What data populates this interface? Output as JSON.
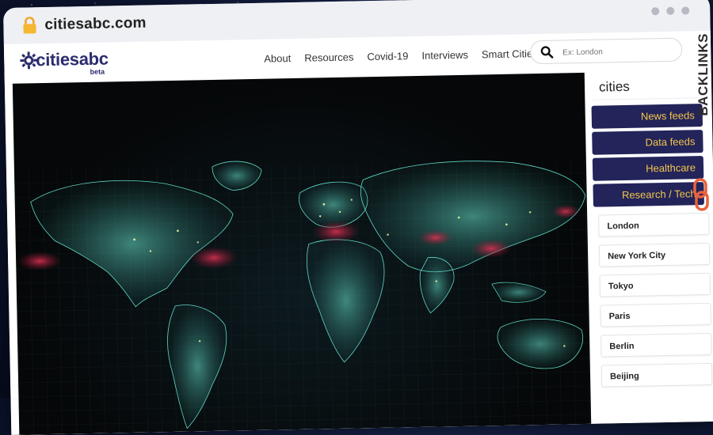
{
  "browser": {
    "url": "citiesabc.com"
  },
  "site": {
    "logo": {
      "name": "citiesabc",
      "badge": "beta"
    },
    "nav": [
      "About",
      "Resources",
      "Covid-19",
      "Interviews",
      "Smart Cities"
    ],
    "search": {
      "placeholder": "Ex: London",
      "value": ""
    }
  },
  "sidebar": {
    "title": "cities",
    "feeds": [
      "News feeds",
      "Data feeds",
      "Healthcare",
      "Research / Tech"
    ],
    "cities": [
      "London",
      "New York City",
      "Tokyo",
      "Paris",
      "Berlin",
      "Beijing"
    ]
  },
  "colors": {
    "nav_button_bg": "#23245a",
    "nav_button_text": "#f3c64a",
    "brand": "#2b2d6e",
    "hero_bg": "#050708",
    "map_glow": "#49d3c4",
    "hotspot": "#d2284b"
  },
  "watermark": {
    "text": "BACKLINKS"
  },
  "icons": {
    "lock": "lock-icon",
    "search": "search-icon",
    "logo": "gear-logo-icon",
    "watermark_link": "chain-link-icon"
  }
}
